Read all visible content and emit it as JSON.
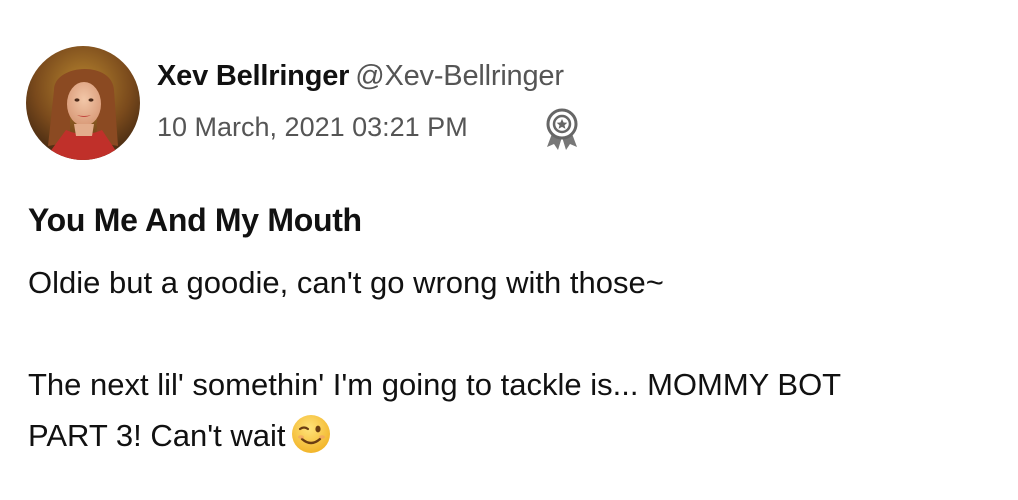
{
  "author": {
    "display_name": "Xev Bellringer",
    "handle": "@Xev-Bellringer",
    "avatar_icon": "profile-photo-avatar"
  },
  "post": {
    "timestamp": "10 March, 2021 03:21 PM",
    "badge_icon": "award-ribbon-icon",
    "title": "You Me And My Mouth",
    "body_line_1": "Oldie but a goodie, can't go wrong with those~",
    "body_line_2": "The next lil' somethin' I'm going to tackle is... MOMMY BOT",
    "body_line_3": "PART 3! Can't wait",
    "emoji": "winking-face-emoji"
  },
  "colors": {
    "text_primary": "#111111",
    "text_secondary": "#555555",
    "background": "#ffffff",
    "emoji_yellow": "#f6c236"
  }
}
